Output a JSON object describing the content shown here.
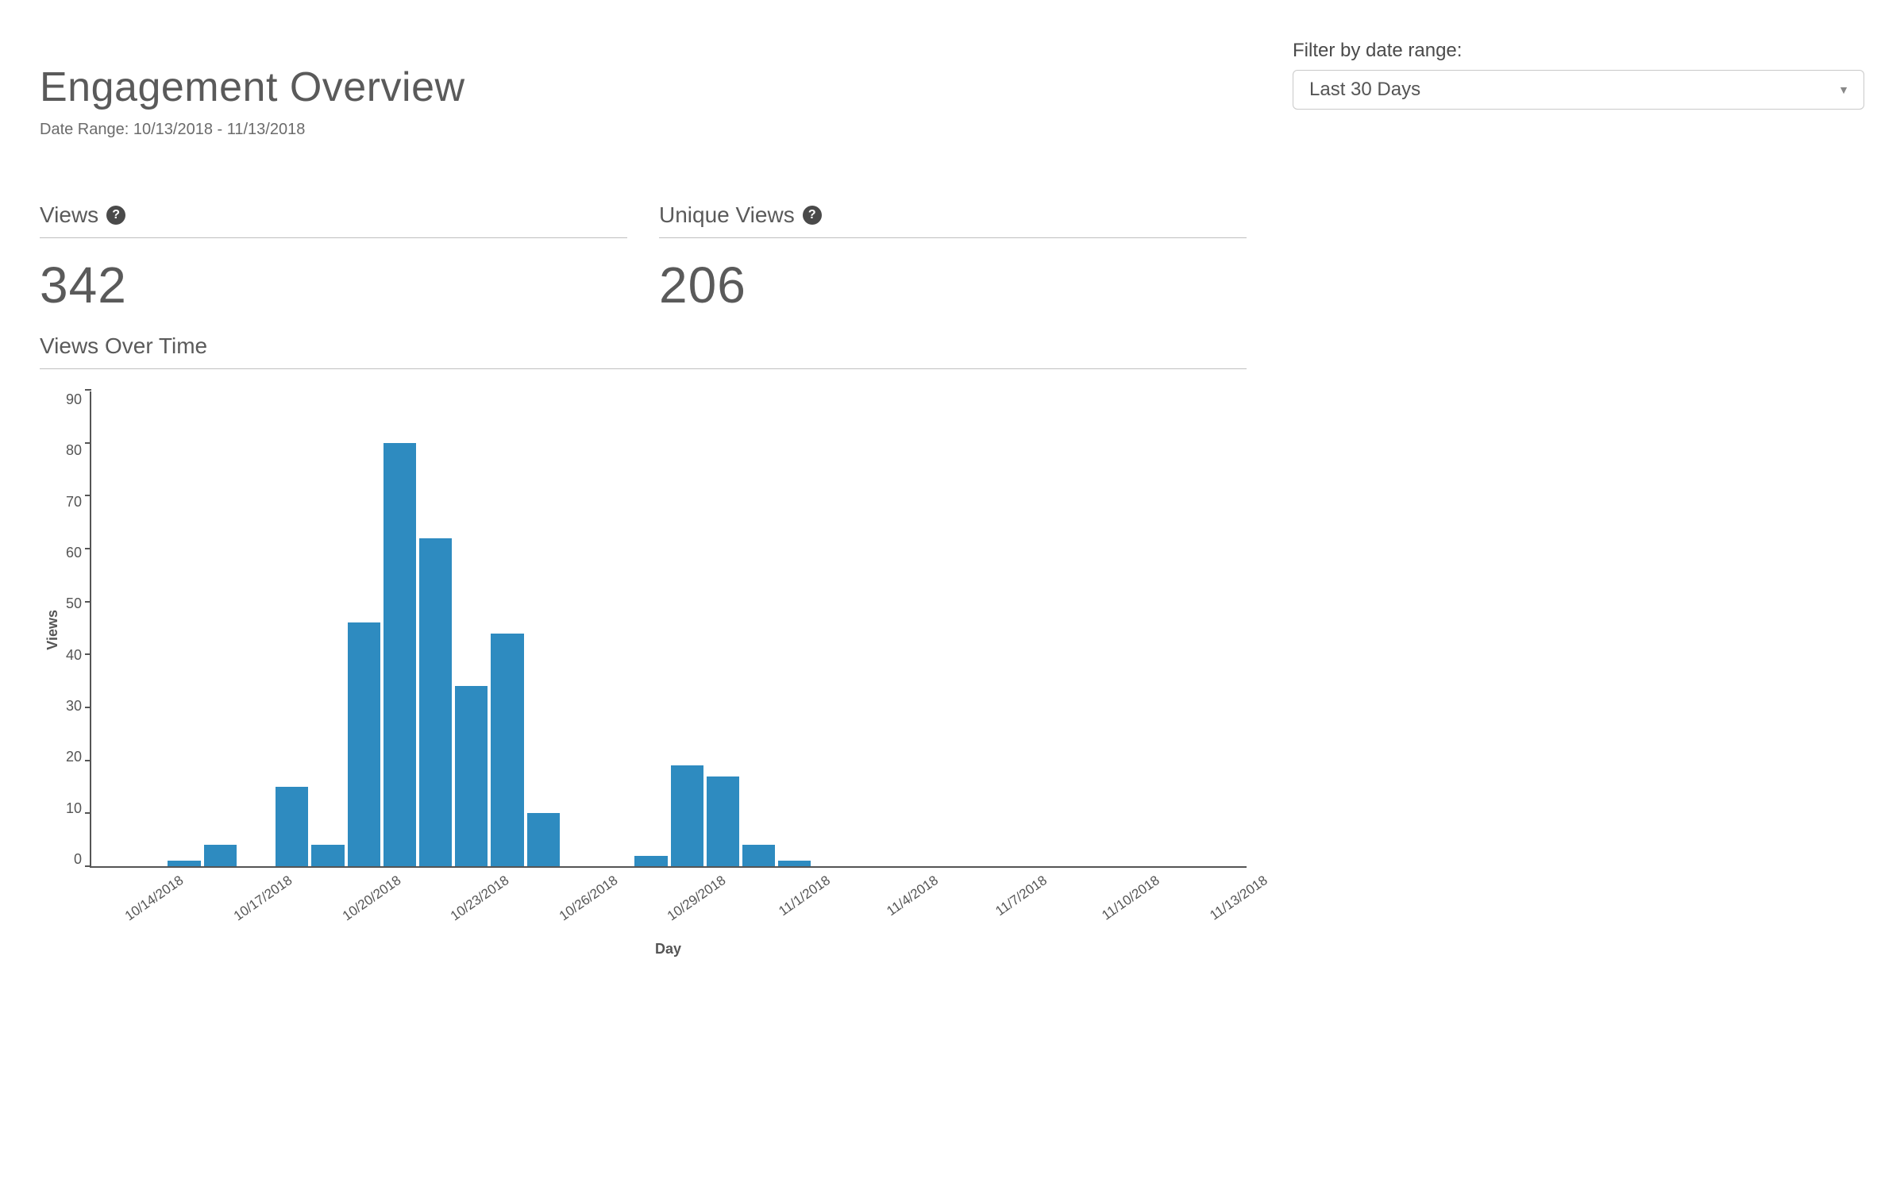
{
  "header": {
    "title": "Engagement Overview",
    "date_range_label": "Date Range: 10/13/2018 - 11/13/2018"
  },
  "filter": {
    "label": "Filter by date range:",
    "selected": "Last 30 Days"
  },
  "stats": {
    "views": {
      "label": "Views",
      "value": "342"
    },
    "unique_views": {
      "label": "Unique Views",
      "value": "206"
    }
  },
  "chart_title": "Views Over Time",
  "chart_data": {
    "type": "bar",
    "title": "Views Over Time",
    "xlabel": "Day",
    "ylabel": "Views",
    "ylim": [
      0,
      90
    ],
    "yticks": [
      0,
      10,
      20,
      30,
      40,
      50,
      60,
      70,
      80,
      90
    ],
    "categories": [
      "10/13/2018",
      "10/14/2018",
      "10/15/2018",
      "10/16/2018",
      "10/17/2018",
      "10/18/2018",
      "10/19/2018",
      "10/20/2018",
      "10/21/2018",
      "10/22/2018",
      "10/23/2018",
      "10/24/2018",
      "10/25/2018",
      "10/26/2018",
      "10/27/2018",
      "10/28/2018",
      "10/29/2018",
      "10/30/2018",
      "10/31/2018",
      "11/1/2018",
      "11/2/2018",
      "11/3/2018",
      "11/4/2018",
      "11/5/2018",
      "11/6/2018",
      "11/7/2018",
      "11/8/2018",
      "11/9/2018",
      "11/10/2018",
      "11/11/2018",
      "11/12/2018",
      "11/13/2018"
    ],
    "values": [
      0,
      0,
      1,
      4,
      0,
      15,
      4,
      46,
      80,
      62,
      34,
      44,
      10,
      0,
      0,
      2,
      19,
      17,
      4,
      1,
      0,
      0,
      0,
      0,
      0,
      0,
      0,
      0,
      0,
      0,
      0,
      0
    ],
    "x_tick_labels": [
      "10/14/2018",
      "10/17/2018",
      "10/20/2018",
      "10/23/2018",
      "10/26/2018",
      "10/29/2018",
      "11/1/2018",
      "11/4/2018",
      "11/7/2018",
      "11/10/2018",
      "11/13/2018"
    ],
    "x_tick_indices": [
      1,
      4,
      7,
      10,
      13,
      16,
      19,
      22,
      25,
      28,
      31
    ],
    "bar_color": "#2e8bc0"
  }
}
